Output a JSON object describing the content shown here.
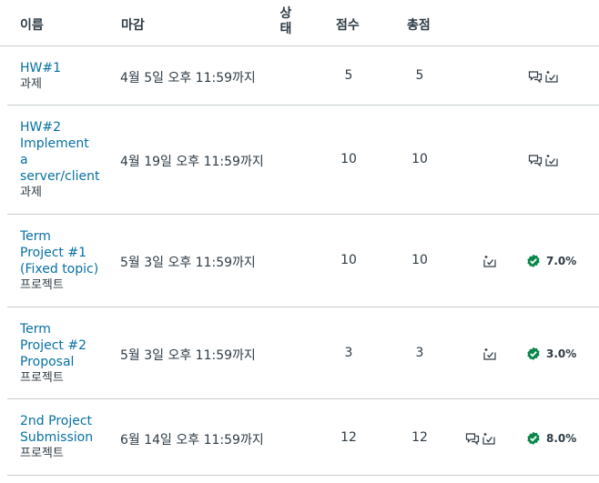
{
  "header": {
    "name": "이름",
    "due": "마감",
    "status_line1": "상",
    "status_line2": "태",
    "score": "점수",
    "total": "총점"
  },
  "rows": [
    {
      "title_lines": [
        "HW#1"
      ],
      "type": "과제",
      "due": "4월 5일 오후 11:59까지",
      "score": "5",
      "total": "5",
      "icons": [
        "comments-icon",
        "rubric-icon"
      ],
      "grade": ""
    },
    {
      "title_lines": [
        "HW#2",
        "Implement",
        "a",
        "server/client"
      ],
      "type": "과제",
      "due": "4월 19일 오후 11:59까지",
      "score": "10",
      "total": "10",
      "icons": [
        "comments-icon",
        "rubric-icon"
      ],
      "grade": ""
    },
    {
      "title_lines": [
        "Term",
        "Project #1",
        "(Fixed topic)"
      ],
      "type": "프로젝트",
      "due": "5월 3일 오후 11:59까지",
      "score": "10",
      "total": "10",
      "icons": [
        "rubric-icon"
      ],
      "grade": "7.0%"
    },
    {
      "title_lines": [
        "Term",
        "Project #2",
        "Proposal"
      ],
      "type": "프로젝트",
      "due": "5월 3일 오후 11:59까지",
      "score": "3",
      "total": "3",
      "icons": [
        "rubric-icon"
      ],
      "grade": "3.0%"
    },
    {
      "title_lines": [
        "2nd Project",
        "Submission"
      ],
      "type": "프로젝트",
      "due": "6월 14일 오후 11:59까지",
      "score": "12",
      "total": "12",
      "icons": [
        "comments-icon",
        "rubric-icon"
      ],
      "grade": "8.0%"
    }
  ],
  "colors": {
    "link": "#0770a3",
    "text": "#2d3b45",
    "divider": "#c7cdd1",
    "success": "#0b874b"
  }
}
